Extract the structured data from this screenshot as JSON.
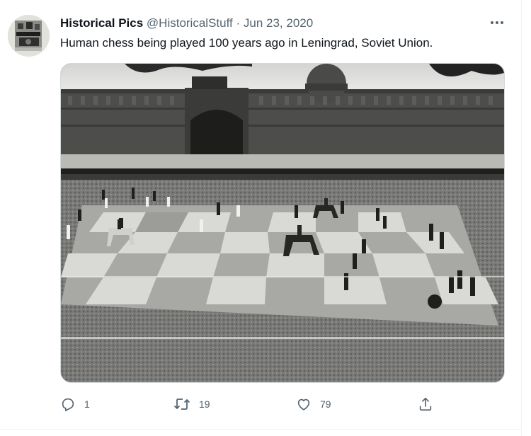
{
  "tweet": {
    "display_name": "Historical Pics",
    "handle": "@HistoricalStuff",
    "separator": "·",
    "date": "Jun 23, 2020",
    "text": "Human chess being played 100 years ago in Leningrad, Soviet Union.",
    "more_icon": "more-horizontal-icon",
    "media_description_icon": "photo"
  },
  "actions": {
    "reply": {
      "icon": "reply-icon",
      "count": "1"
    },
    "retweet": {
      "icon": "retweet-icon",
      "count": "19"
    },
    "like": {
      "icon": "heart-icon",
      "count": "79"
    },
    "share": {
      "icon": "share-icon"
    }
  },
  "colors": {
    "text_primary": "#0f1419",
    "text_secondary": "#536471",
    "border": "#cfd9de"
  }
}
